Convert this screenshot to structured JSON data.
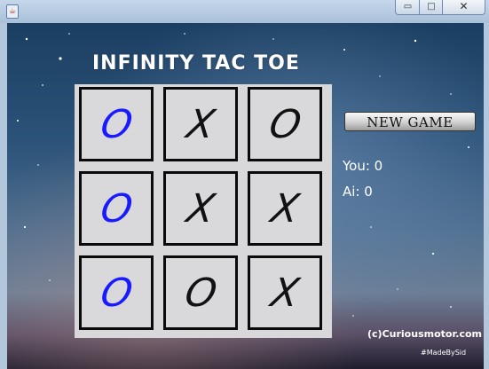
{
  "window": {
    "app_icon": "java-icon",
    "controls": {
      "minimize": "▭",
      "maximize": "□",
      "close": "✕"
    }
  },
  "game": {
    "title": "INFINITY TAC TOE",
    "board": [
      [
        {
          "mark": "O",
          "color": "#1a1aff"
        },
        {
          "mark": "X",
          "color": "#111111"
        },
        {
          "mark": "O",
          "color": "#111111"
        }
      ],
      [
        {
          "mark": "O",
          "color": "#1a1aff"
        },
        {
          "mark": "X",
          "color": "#111111"
        },
        {
          "mark": "X",
          "color": "#111111"
        }
      ],
      [
        {
          "mark": "O",
          "color": "#1a1aff"
        },
        {
          "mark": "O",
          "color": "#111111"
        },
        {
          "mark": "X",
          "color": "#111111"
        }
      ]
    ],
    "new_game_label": "NEW GAME",
    "score_you": "You: 0",
    "score_ai": "Ai: 0",
    "credit": "(c)Curiousmotor.com",
    "hashtag": "#MadeBySid"
  },
  "colors": {
    "human_mark": "#1a1aff",
    "ai_mark": "#111111",
    "cell_bg": "#d9d9dc"
  }
}
